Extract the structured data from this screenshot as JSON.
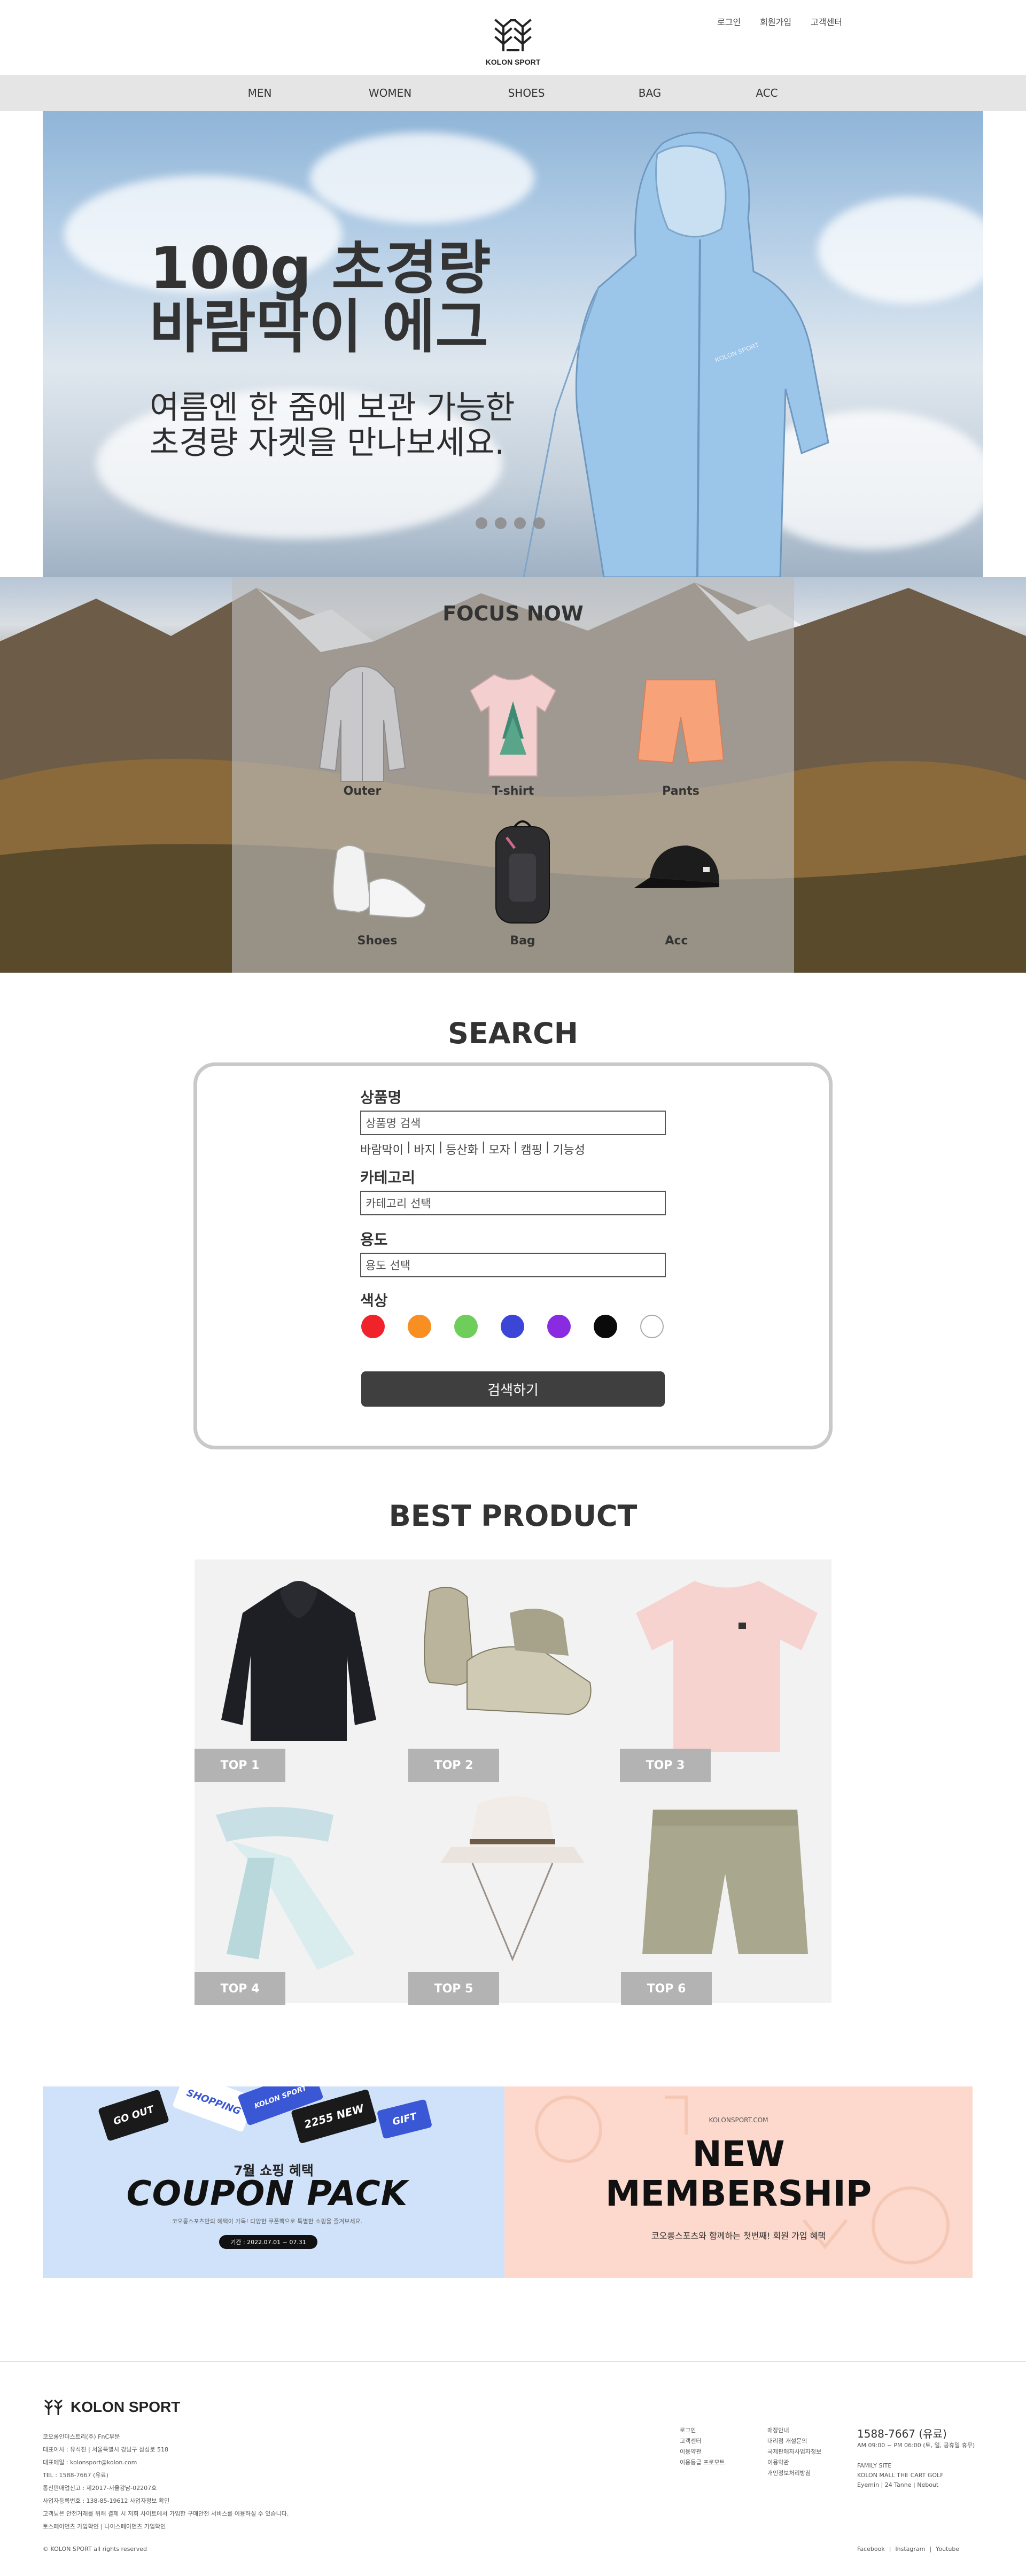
{
  "header": {
    "logo_text": "KOLON SPORT",
    "util": [
      "로그인",
      "회원가입",
      "고객센터"
    ],
    "nav": [
      "MEN",
      "WOMEN",
      "SHOES",
      "BAG",
      "ACC"
    ]
  },
  "hero": {
    "title": "100g 초경량\n바람막이 에그",
    "subtitle": "여름엔 한 줌에 보관 가능한\n초경량 자켓을 만나보세요.",
    "slide_count": 4
  },
  "focus": {
    "title": "FOCUS NOW",
    "items": [
      "Outer",
      "T-shirt",
      "Pants",
      "Shoes",
      "Bag",
      "Acc"
    ]
  },
  "search": {
    "title": "SEARCH",
    "product_label": "상품명",
    "product_placeholder": "상품명 검색",
    "tags": [
      "바람막이",
      "|",
      "바지",
      "|",
      "등산화",
      "|",
      "모자",
      "|",
      "캠핑",
      "|",
      "기능성"
    ],
    "category_label": "카테고리",
    "category_placeholder": "카테고리 선택",
    "usage_label": "용도",
    "usage_placeholder": "용도 선택",
    "color_label": "색상",
    "colors": [
      "#f0222a",
      "#f98f22",
      "#6fce5a",
      "#3b46d6",
      "#8a2be2",
      "#0a0a0a",
      "#ffffff"
    ],
    "button": "검색하기"
  },
  "best": {
    "title": "BEST PRODUCT",
    "badges": [
      "TOP 1",
      "TOP 2",
      "TOP 3",
      "TOP 4",
      "TOP 5",
      "TOP 6"
    ]
  },
  "coupon": {
    "tags": [
      "GO OUT",
      "SHOPPING",
      "KOLON SPORT",
      "2255 NEW",
      "GIFT"
    ],
    "subtitle": "7월 쇼핑 혜택",
    "title": "COUPON PACK",
    "desc": "코오롱스포츠만의 혜택이 가득! 다양한 쿠폰팩으로 특별한 쇼핑을 즐겨보세요.",
    "period": "기간 : 2022.07.01 ~ 07.31"
  },
  "membership": {
    "url": "KOLONSPORT.COM",
    "title": "NEW\nMEMBERSHIP",
    "desc": "코오롱스포츠와 함께하는 첫번째! 회원 가입 혜택"
  },
  "footer": {
    "logo_text": "KOLON SPORT",
    "info": [
      "코오롱인더스트리(주) FnC부문",
      "대표이사 : 유석진 | 서울특별시 강남구 삼성로 518",
      "대표메일 : kolonsport@kolon.com",
      "TEL : 1588-7667 (유료)",
      "통신판매업신고 : 제2017-서울강남-02207호",
      "사업자등록번호 : 138-85-19612 사업자정보 확인",
      "고객님은 안전거래를 위해 결제 시 저희 사이트에서 가입한 구매안전 서비스를 이용하실 수 있습니다.",
      "",
      "토스페이먼츠 가입확인 | 나이스페이먼츠 가입확인"
    ],
    "copyright": "© KOLON SPORT all rights reserved",
    "col1": [
      "로그인",
      "고객센터",
      "이용약관",
      "이용등급 프로모트"
    ],
    "col2": [
      "매장안내",
      "대리점 개설문의",
      "국제판매자사업자정보",
      "이용약관",
      "개인정보처리방침"
    ],
    "tel": "1588-7667 (유료)",
    "hours": "AM 09:00 ~ PM 06:00 (토, 일, 공휴일 휴무)",
    "family_title": "FAMILY SITE",
    "family_1": "KOLON MALL THE CART GOLF",
    "family_2": "Eyemin  |  24 Tanne  |  Nebout",
    "social": [
      "Facebook",
      "|",
      "Instagram",
      "|",
      "Youtube"
    ]
  }
}
